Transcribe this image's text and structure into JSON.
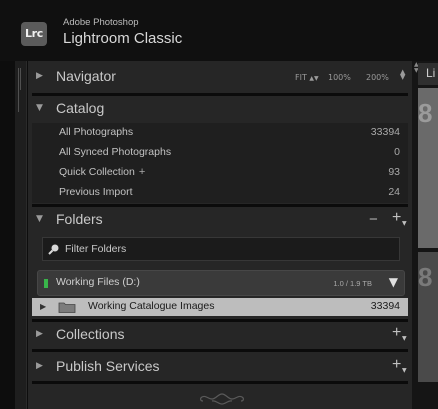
{
  "identity": {
    "logo_text": "Lrc",
    "vendor": "Adobe Photoshop",
    "app_name": "Lightroom Classic"
  },
  "navigator": {
    "title": "Navigator",
    "zoom_fit": "FIT",
    "zoom_100": "100%",
    "zoom_200": "200%"
  },
  "catalog": {
    "title": "Catalog",
    "items": [
      {
        "label": "All Photographs",
        "count": "33394"
      },
      {
        "label": "All Synced Photographs",
        "count": "0"
      },
      {
        "label": "Quick Collection",
        "suffix": "+",
        "count": "93"
      },
      {
        "label": "Previous Import",
        "count": "24"
      }
    ]
  },
  "folders": {
    "title": "Folders",
    "minus": "−",
    "plus": "+",
    "filter_placeholder": "Filter Folders",
    "volume": {
      "name": "Working Files (D:)",
      "size": "1.0 / 1.9 TB",
      "status_color": "#39b54a"
    },
    "items": [
      {
        "name": "Working Catalogue Images",
        "count": "33394"
      }
    ]
  },
  "collections": {
    "title": "Collections",
    "plus": "+"
  },
  "publish_services": {
    "title": "Publish Services",
    "plus": "+"
  },
  "right_panel": {
    "tab_label": "Li",
    "digit_top": "8",
    "digit_bottom": "8"
  }
}
